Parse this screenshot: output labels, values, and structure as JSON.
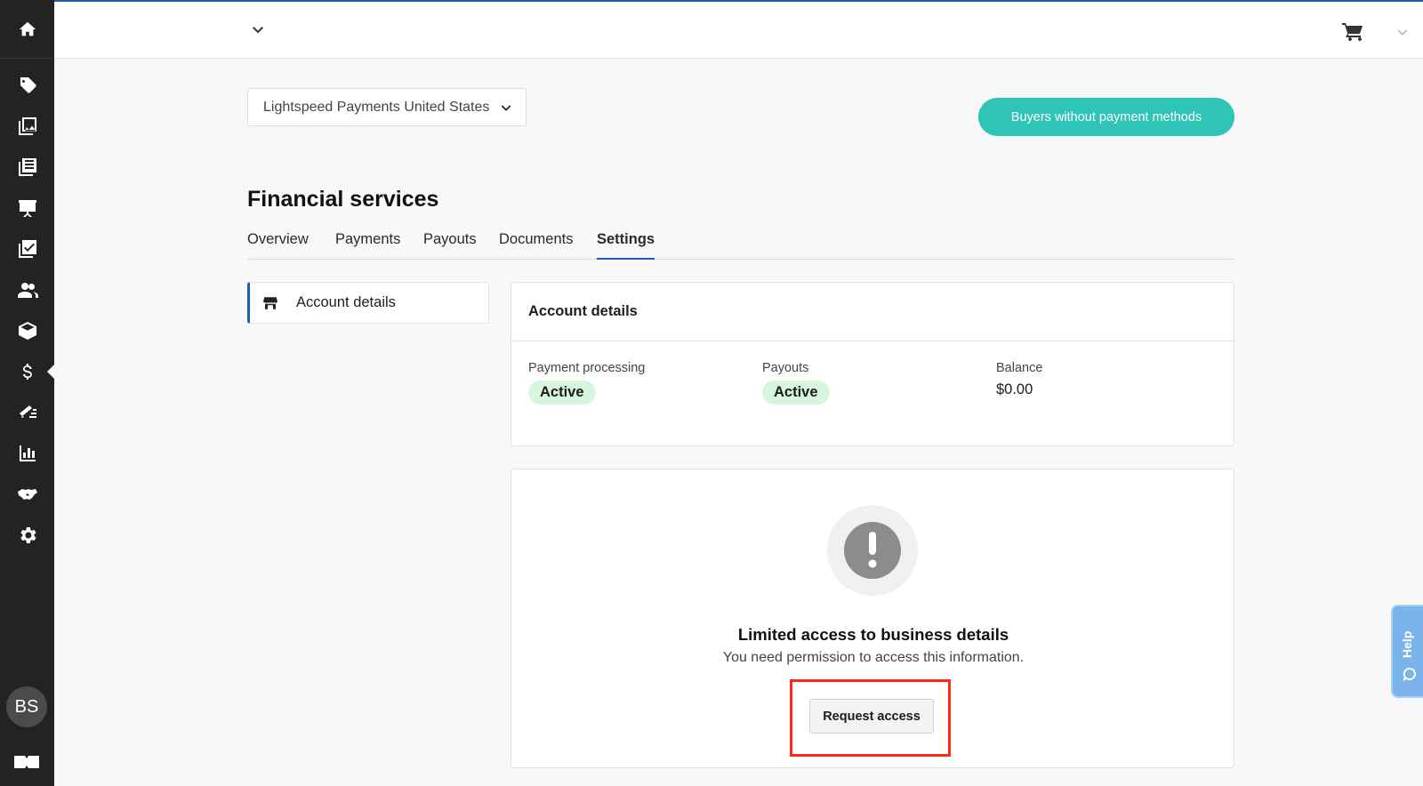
{
  "sidebar": {
    "icons": [
      "home-icon",
      "tag-icon",
      "gallery-icon",
      "catalog-icon",
      "presentation-icon",
      "checklist-icon",
      "customers-icon",
      "box-icon",
      "dollar-icon",
      "invoice-icon",
      "reports-icon",
      "handshake-icon",
      "gear-icon"
    ],
    "active": "dollar-icon",
    "avatar_initials": "BS"
  },
  "location_select": {
    "value": "Lightspeed Payments United States"
  },
  "buyers_button": {
    "label": "Buyers without payment methods"
  },
  "page_title": "Financial services",
  "tabs": [
    {
      "label": "Overview",
      "active": false
    },
    {
      "label": "Payments",
      "active": false
    },
    {
      "label": "Payouts",
      "active": false
    },
    {
      "label": "Documents",
      "active": false
    },
    {
      "label": "Settings",
      "active": true
    }
  ],
  "side_nav": {
    "label": "Account details"
  },
  "account_card": {
    "title": "Account details",
    "payment_processing": {
      "label": "Payment processing",
      "status": "Active"
    },
    "payouts": {
      "label": "Payouts",
      "status": "Active"
    },
    "balance": {
      "label": "Balance",
      "value": "$0.00"
    }
  },
  "limited_access": {
    "title": "Limited access to business details",
    "description": "You need permission to access this information.",
    "button_label": "Request access"
  },
  "help": {
    "label": "Help"
  },
  "colors": {
    "accent": "#2ec4b6",
    "tab_underline": "#1a5fb4",
    "badge_bg": "#d8f5dd",
    "highlight": "#ff2a1a"
  }
}
